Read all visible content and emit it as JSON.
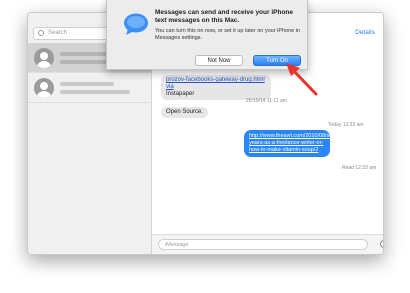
{
  "window": {
    "sidebar": {
      "search_placeholder": "Search"
    },
    "header": {
      "details_label": "Details"
    },
    "messages": {
      "link_line": "prozov-facebooks-gateway-drug.html via",
      "link_source": "Instapaper",
      "ts1": "25/10/14 11:11 am",
      "open_source": "Open Source.",
      "today_label": "Today 12:33 am",
      "blue_link": "http://www.theawl.com/2010/08/seven-years-as-a-freelance-writer-or-how-to-make-vitamin-soup/2",
      "read_receipt": "Read 12:33 am"
    },
    "input": {
      "placeholder": "iMessage"
    }
  },
  "notification": {
    "title": "Messages can send and receive your iPhone text messages on this Mac.",
    "body": "You can turn this on now, or set it up later on your iPhone in Messages settings.",
    "not_now_label": "Not Now",
    "turn_on_label": "Turn On"
  },
  "colors": {
    "accent": "#2a86f5",
    "annotation_arrow": "#e8322b"
  }
}
